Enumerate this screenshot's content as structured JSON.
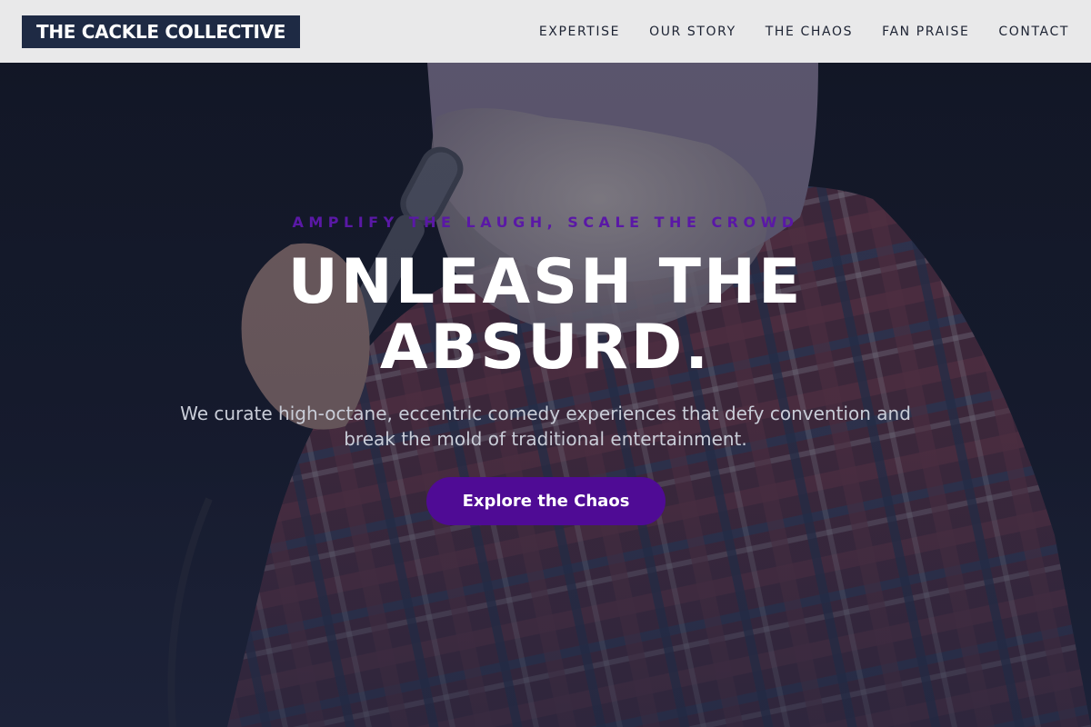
{
  "nav": {
    "logo": "THE CACKLE COLLECTIVE",
    "items": [
      {
        "label": "EXPERTISE"
      },
      {
        "label": "OUR STORY"
      },
      {
        "label": "THE CHAOS"
      },
      {
        "label": "FAN PRAISE"
      },
      {
        "label": "CONTACT"
      }
    ]
  },
  "hero": {
    "eyebrow": "AMPLIFY THE LAUGH, SCALE THE CROWD",
    "headline_line1": "UNLEASH THE",
    "headline_line2": "ABSURD.",
    "subtext": "We curate high-octane, eccentric comedy experiences that defy convention and break the mold of traditional entertainment.",
    "cta_label": "Explore the Chaos",
    "background_image": "comedian-with-microphone-photo"
  },
  "colors": {
    "nav_bg": "#e9e9ea",
    "logo_bg": "#1e2a44",
    "accent": "#4f0b95",
    "eyebrow": "#5a18a6",
    "hero_dark": "#161c2c"
  }
}
